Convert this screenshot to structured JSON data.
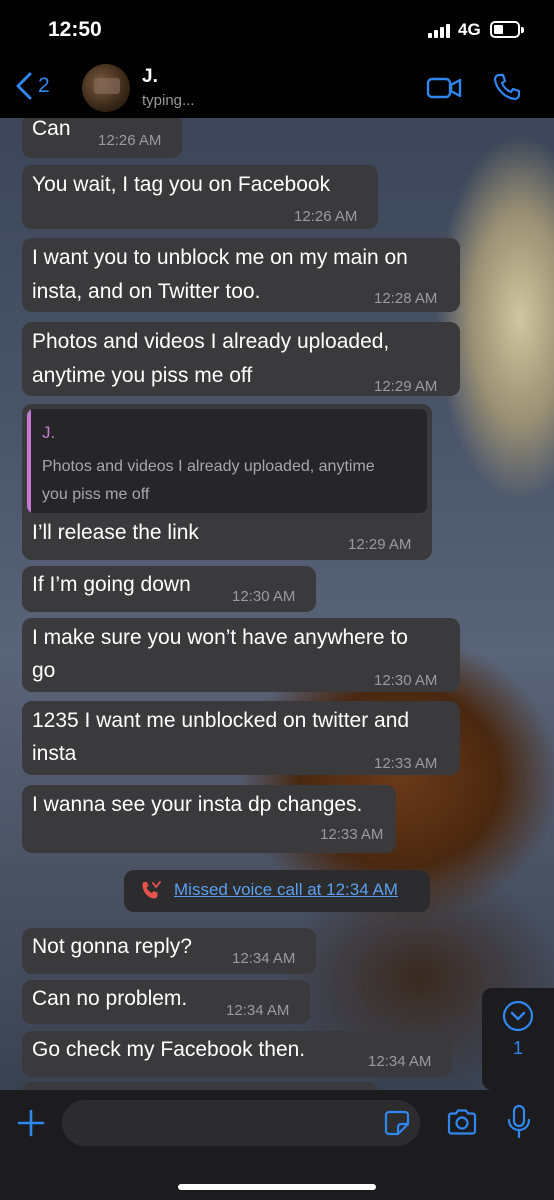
{
  "status": {
    "time": "12:50",
    "network": "4G"
  },
  "header": {
    "back_count": "2",
    "contact_name": "J.",
    "contact_status": "typing..."
  },
  "messages": [
    {
      "text": "Can",
      "time": "12:26 AM"
    },
    {
      "text": "You wait, I tag you on Facebook",
      "time": "12:26 AM"
    },
    {
      "text_lines": [
        "I want you to unblock me on my main on",
        "insta, and on Twitter too."
      ],
      "time": "12:28 AM"
    },
    {
      "text_lines": [
        "Photos and videos I already uploaded,",
        "anytime you piss me off"
      ],
      "time": "12:29 AM"
    },
    {
      "quote": {
        "name": "J.",
        "text_lines": [
          "Photos and videos I already uploaded, anytime",
          "you piss me off"
        ]
      },
      "text": "I’ll release the link",
      "time": "12:29 AM"
    },
    {
      "text": "If I’m going down",
      "time": "12:30 AM"
    },
    {
      "text_lines": [
        "I make sure you won’t have anywhere to",
        "go"
      ],
      "time": "12:30 AM"
    },
    {
      "text_lines": [
        "1235 I want me unblocked on twitter and",
        "insta"
      ],
      "time": "12:33 AM"
    },
    {
      "text": "I wanna see your insta dp changes.",
      "time": "12:33 AM"
    },
    {
      "text": "Not gonna reply?",
      "time": "12:34 AM"
    },
    {
      "text": "Can no problem.",
      "time": "12:34 AM"
    },
    {
      "text": "Go check my Facebook then.",
      "time": "12:34 AM"
    }
  ],
  "missed_call": {
    "text": "Missed voice call at 12:34 AM",
    "icon": "missed-call-icon"
  },
  "scroll_down": {
    "count": "1"
  },
  "input": {
    "placeholder": ""
  },
  "colors": {
    "accent": "#2f87f0",
    "bubble": "#3a3a3c",
    "quote_name": "#c57ad6",
    "missed_call": "#e5534b"
  }
}
